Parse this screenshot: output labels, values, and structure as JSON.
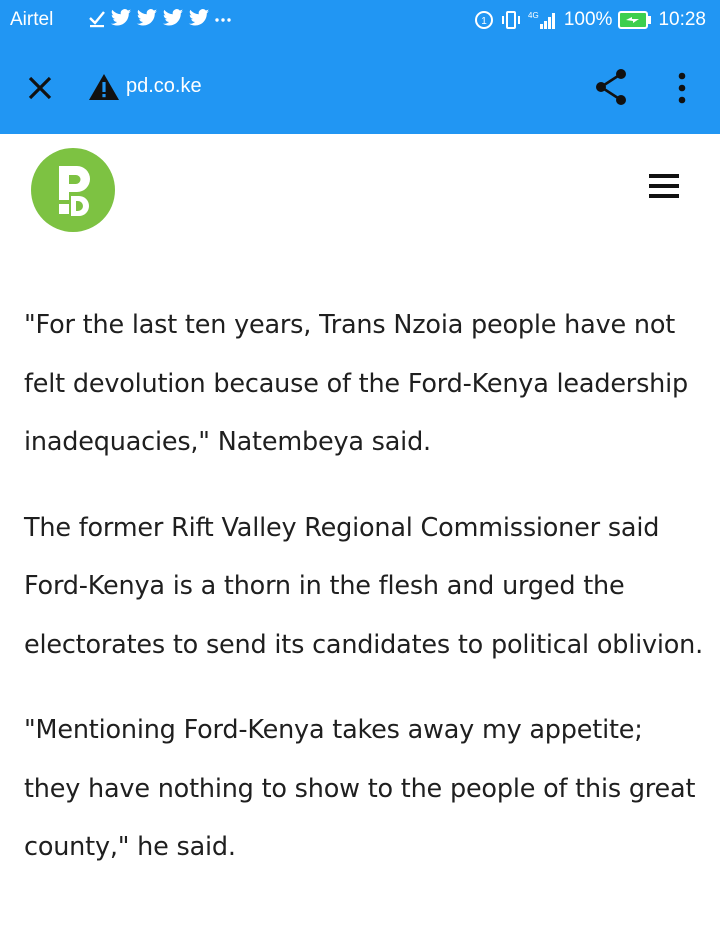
{
  "status_bar": {
    "carrier": "Airtel",
    "battery": "100%",
    "time": "10:28",
    "network": "4G"
  },
  "browser_toolbar": {
    "url": "pd.co.ke",
    "icons": [
      "close-icon",
      "warning-icon",
      "share-icon",
      "more-vert-icon"
    ]
  },
  "site": {
    "logo_letters": "PD",
    "brand_color": "#7dc242",
    "menu_icon": "hamburger-icon"
  },
  "article": {
    "paragraphs": [
      "\"For the last ten years, Trans Nzoia people have not felt devolution because of the Ford-Kenya leadership inadequacies,\" Natembeya said.",
      "The former Rift Valley Regional Commissioner said Ford-Kenya is a thorn in the flesh and urged the electorates to send its candidates to political oblivion.",
      "\"Mentioning Ford-Kenya takes away my appetite; they have nothing to show to the people of this great county,\" he said."
    ]
  },
  "colors": {
    "toolbar": "#2196f3",
    "text": "#1f1f1f"
  }
}
